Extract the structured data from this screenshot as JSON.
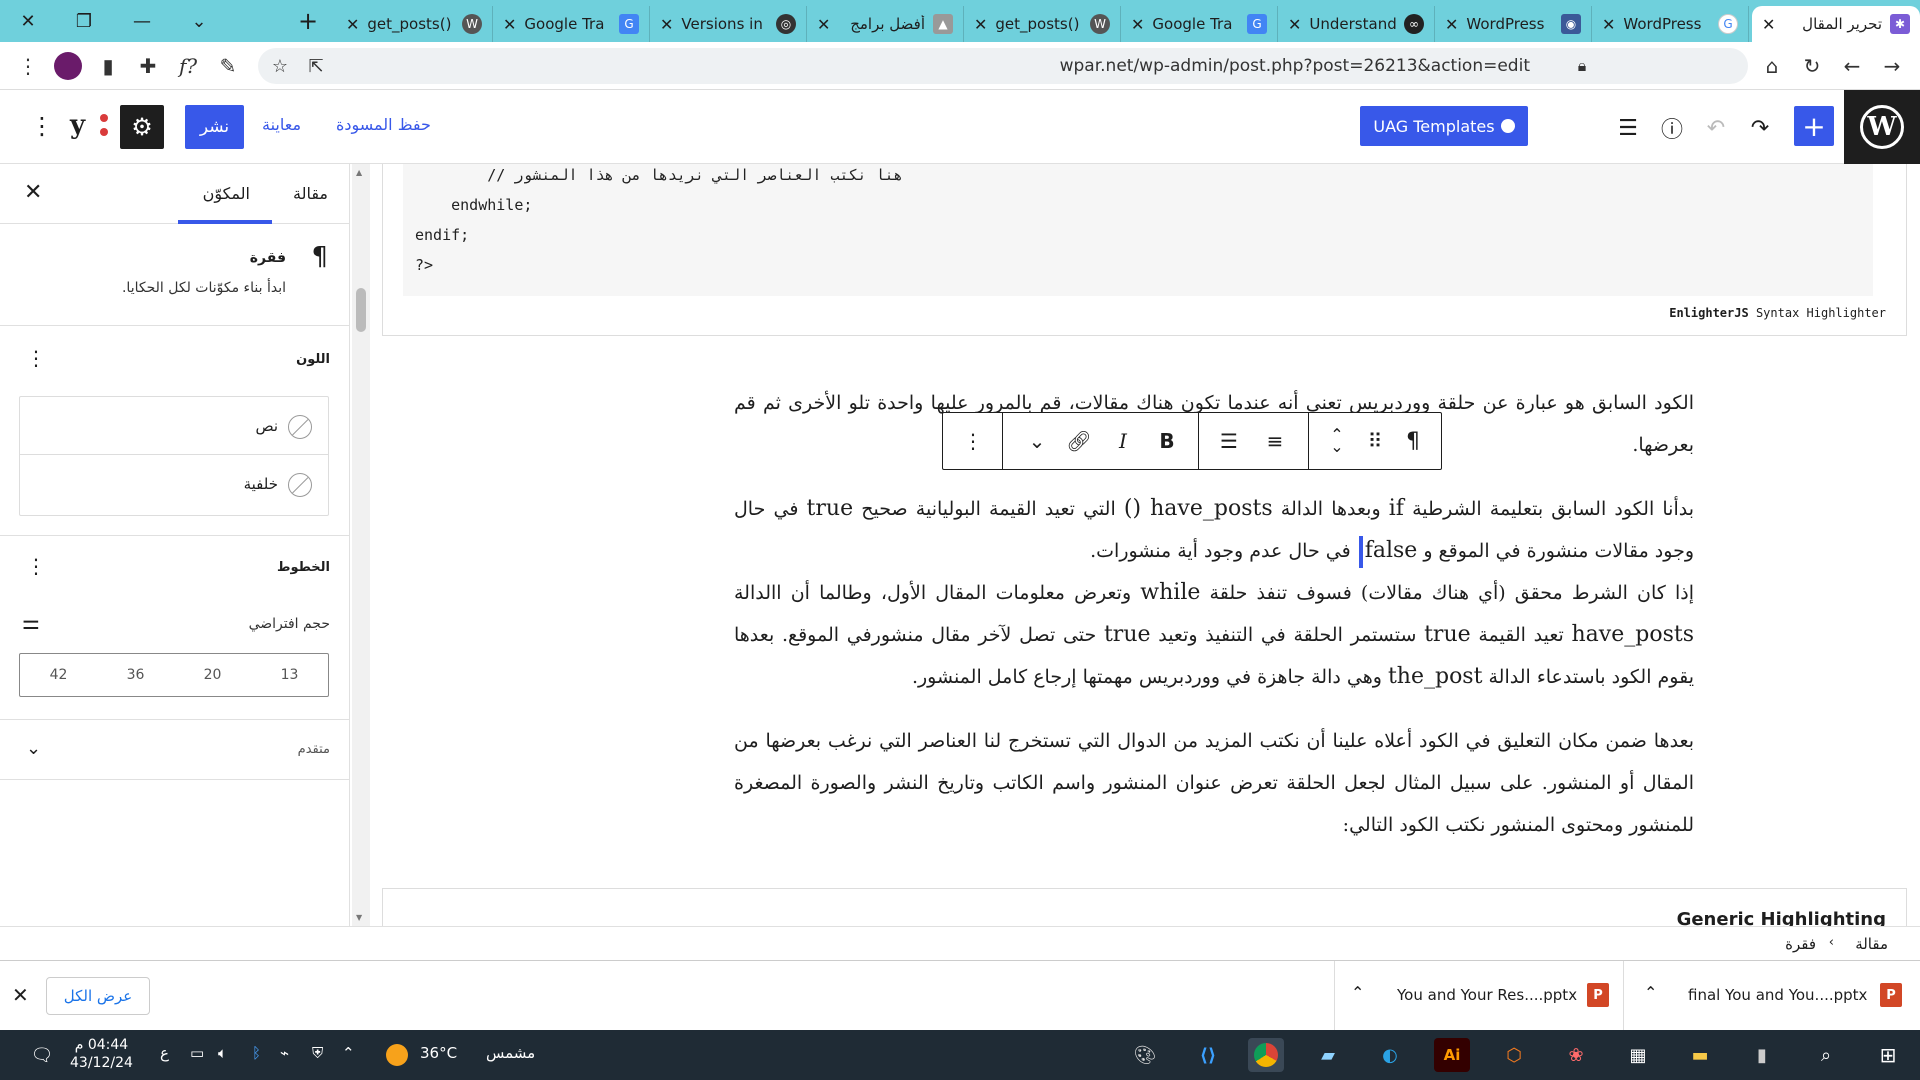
{
  "browser": {
    "tabs": [
      {
        "title": "تحرير المقال",
        "active": true
      },
      {
        "title": "WordPress"
      },
      {
        "title": "WordPress"
      },
      {
        "title": "Understand"
      },
      {
        "title": "Google Tra"
      },
      {
        "title": "get_posts()"
      },
      {
        "title": "أفضل برامج"
      },
      {
        "title": "Versions in"
      },
      {
        "title": "Google Tra"
      },
      {
        "title": "get_posts()"
      }
    ],
    "url": "wpar.net/wp-admin/post.php?post=26213&action=edit"
  },
  "wp_toolbar": {
    "publish": "نشر",
    "preview": "معاينة",
    "save_draft": "حفظ المسودة",
    "uag_templates": "UAG Templates",
    "yoast": "y"
  },
  "sidebar": {
    "tab_post": "مقالة",
    "tab_block": "المكوّن",
    "block_name": "فقرة",
    "block_desc": "ابدأ بناء مكوّنات لكل الحكايا.",
    "color_title": "اللون",
    "color_text": "نص",
    "color_background": "خلفية",
    "typography_title": "الخطوط",
    "size_label": "حجم افتراضي",
    "sizes": [
      "13",
      "20",
      "36",
      "42"
    ],
    "advanced_title": "متقدم"
  },
  "code": {
    "lines": [
      "        // هنا نكتب العناصر التي نريدها من هذا المنشور",
      "    endwhile;",
      "endif;",
      "?>"
    ],
    "highlighter_brand": "EnlighterJS",
    "highlighter_rest": " Syntax Highlighter"
  },
  "content": {
    "para1": "الكود السابق هو عبارة عن حلقة ووردبريس تعني أنه عندما تكون هناك مقالات، قم بالمرور عليها واحدة تلو الأخرى ثم قم بعرضها.",
    "para2_a": "بدأنا الكود السابق بتعليمة الشرطية ",
    "para2_if": "if",
    "para2_b": " وبعدها الدالة ",
    "para2_hp": "have_posts ()",
    "para2_c": " التي تعيد القيمة البوليانية صحيح ",
    "para2_true": "true",
    "para2_d": " في حال وجود مقالات منشورة في الموقع و ",
    "para2_false": "false",
    "para2_e": " في حال عدم وجود أية منشورات.",
    "para3_a": "إذا كان الشرط محقق (أي هناك مقالات) فسوف تنفذ حلقة ",
    "para3_while": "while",
    "para3_b": " وتعرض معلومات المقال الأول، وطالما أن االدالة ",
    "para3_hp": "have_posts",
    "para3_c": " تعيد القيمة ",
    "para3_true": "true",
    "para3_d": " ستستمر الحلقة في التنفيذ وتعيد ",
    "para3_true2": "true",
    "para3_e": " حتى تصل لآخر مقال منشورفي الموقع. بعدها يقوم الكود باستدعاء الدالة ",
    "para3_tp": "the_post",
    "para3_f": " وهي دالة جاهزة في ووردبريس مهمتها إرجاع كامل المنشور.",
    "para4": "بعدها ضمن مكان التعليق في الكود أعلاه علينا أن نكتب المزيد من الدوال التي تستخرج لنا العناصر التي نرغب بعرضها من المقال أو المنشور. على سبيل المثال لجعل الحلقة تعرض عنوان المنشور واسم الكاتب وتاريخ النشر والصورة المصغرة للمنشور ومحتوى المنشور نكتب الكود التالي:",
    "generic_heading": "Generic Highlighting"
  },
  "breadcrumb": {
    "root": "مقالة",
    "current": "فقرة"
  },
  "downloads": {
    "file1": "final You and You....pptx",
    "file2": "You and Your Res....pptx",
    "show_all": "عرض الكل",
    "ppt_letter": "P"
  },
  "taskbar": {
    "weather": "مشمس",
    "temp": "36°C",
    "time": "04:44 م",
    "date": "43/12/24",
    "lang": "ع"
  }
}
